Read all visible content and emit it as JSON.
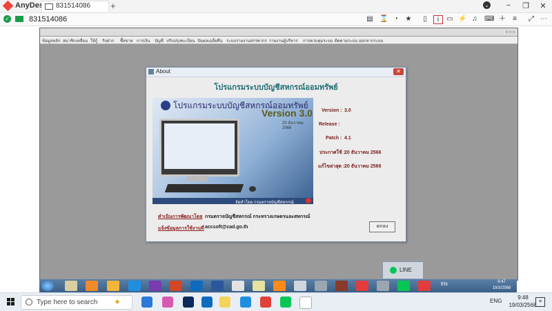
{
  "anydesk": {
    "app_name": "AnyDesk",
    "tab_label": "831514086",
    "address": "831514086",
    "menu_glyph": "⌄",
    "minimize_glyph": "−",
    "maximize_glyph": "❐",
    "close_glyph": "✕"
  },
  "app_window": {
    "menu_items": [
      "ข้อมูลหลัก",
      "สมาชิกเคลื่อน",
      "ให้กู้",
      "รับฝาก",
      "ซื้อขาย",
      "การเงิน",
      "บัญชี",
      "ปรับปรุงทะเบียน",
      "ปันผลเฉลี่ยคืน",
      "ระบบรายงานสรรพากร",
      "รายงานผู้บริหาร",
      "การควบคุมระบบ",
      "ติดตามระบบ",
      "ออกจากระบบ"
    ],
    "ctl": "▫ ▫ ▫"
  },
  "about": {
    "title": "About",
    "close_glyph": "✕",
    "heading": "โปรแกรมระบบบัญชีสหกรณ์ออมทรัพย์",
    "splash": {
      "title": "โปรแกรมระบบบัญชีสหกรณ์ออมทรัพย์",
      "version": "Version 3.0",
      "date": "20 ธันวาคม 2566",
      "footer": "จัดทำโดย กรมตรวจบัญชีสหกรณ์"
    },
    "version_label": "Version :",
    "version_value": "3.0",
    "release_label": "Release :",
    "patch_label": "Patch :",
    "patch_value": "4.1",
    "release_date_label": "ประกาศใช้ :",
    "release_date_value": "20 ธันวาคม 2566",
    "updated_label": "แก้ไขล่าสุด :",
    "updated_value": "20 ธันวาคม 2566",
    "developer_link": "ดำเนินการพัฒนาโดย",
    "developer_value": "กรมตรวจบัญชีสหกรณ์ กระทรวงเกษตรและสหกรณ์",
    "contact_link": "แจ้งข้อมูลการใช้งานที่",
    "contact_value": "accsoft@cad.go.th",
    "ok_label": "ตกลง"
  },
  "line_popup": {
    "label": "LINE"
  },
  "inner_taskbar": {
    "lang": "EN",
    "time": "9:47",
    "date": "19/3/2568"
  },
  "host_taskbar": {
    "search_placeholder": "Type here to search",
    "lang": "ENG",
    "time": "9:48",
    "date": "19/03/2568"
  }
}
